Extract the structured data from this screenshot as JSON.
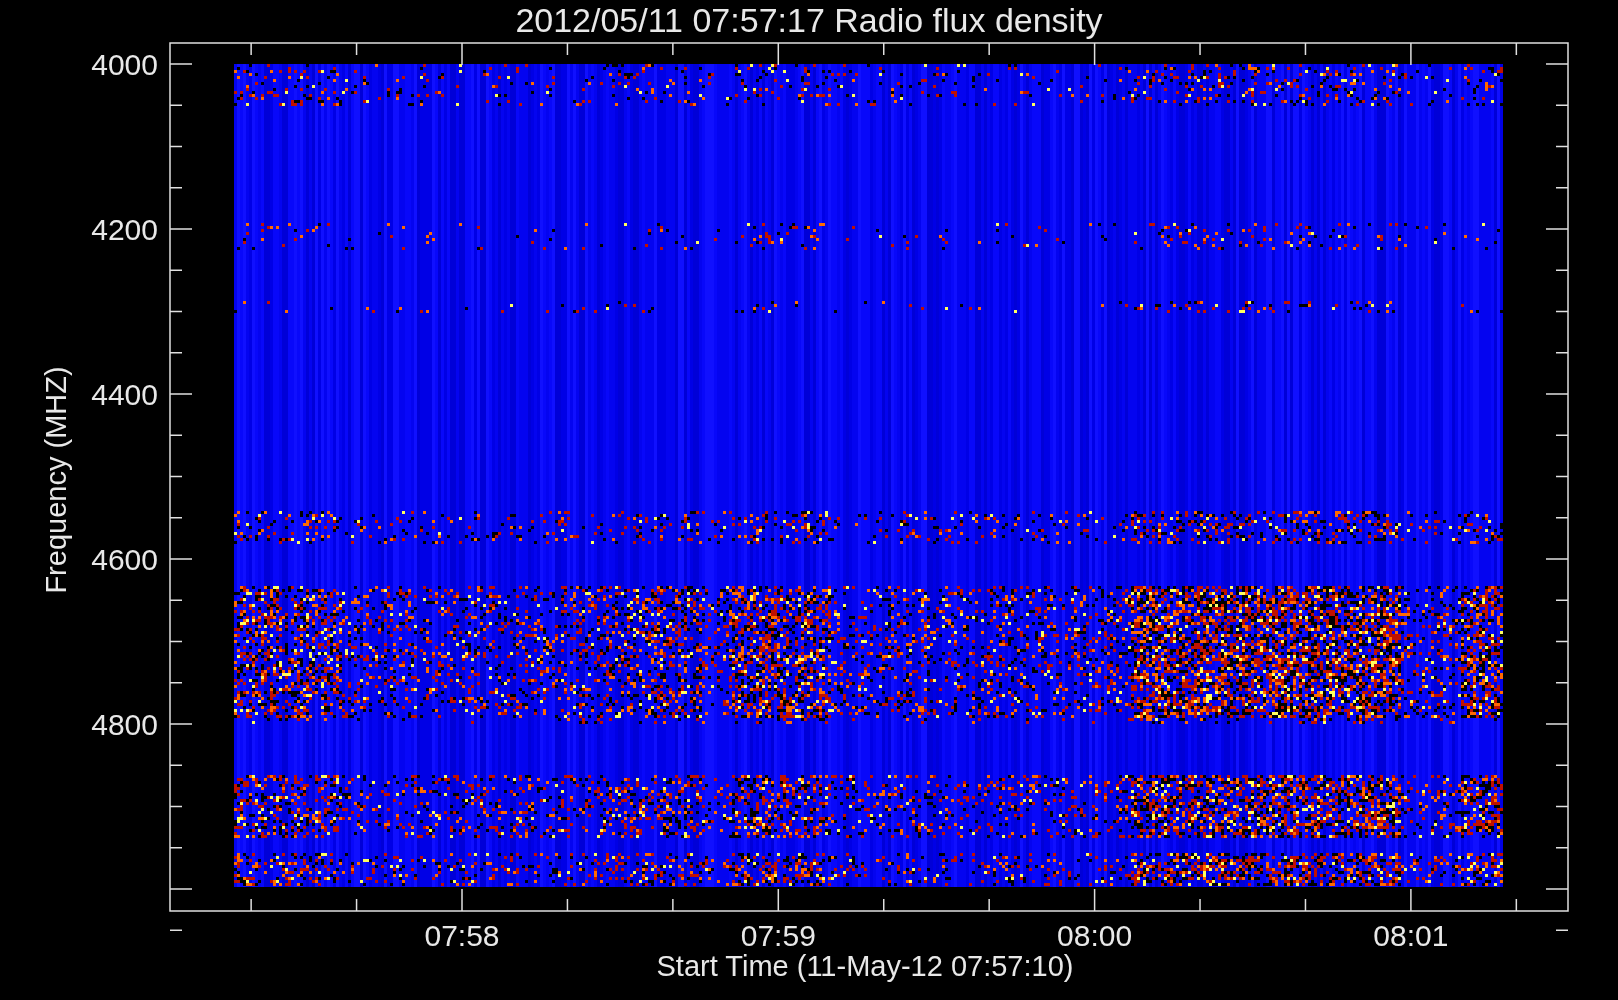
{
  "title": "2012/05/11 07:57:17 Radio flux density",
  "plot": {
    "ylabel": "Frequency (MHZ)",
    "xlabel": "Start Time (11-May-12 07:57:10)",
    "yticks": [
      "4000",
      "4200",
      "4400",
      "4600",
      "4800"
    ],
    "xticks": [
      "07:58",
      "07:59",
      "08:00",
      "08:01"
    ]
  }
}
